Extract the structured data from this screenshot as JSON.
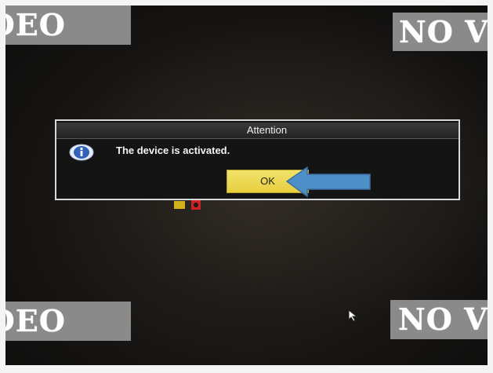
{
  "background": {
    "tiles": [
      "NO VIDEO",
      "NO VIDEO",
      "NO VIDEO",
      "NO VIDEO"
    ],
    "tile_visible_text": [
      "IDEO",
      "NO V",
      "IDEO",
      "NO V"
    ]
  },
  "dialog": {
    "title": "Attention",
    "icon": "info-icon",
    "message": "The device is activated.",
    "ok_label": "OK"
  },
  "annotation": {
    "arrow": "blue-arrow-pointing-left",
    "arrow_color": "#4f8fc8"
  },
  "colors": {
    "ok_button": "#ead647",
    "dialog_border": "#d8d8d8",
    "dialog_bg": "#141414"
  }
}
